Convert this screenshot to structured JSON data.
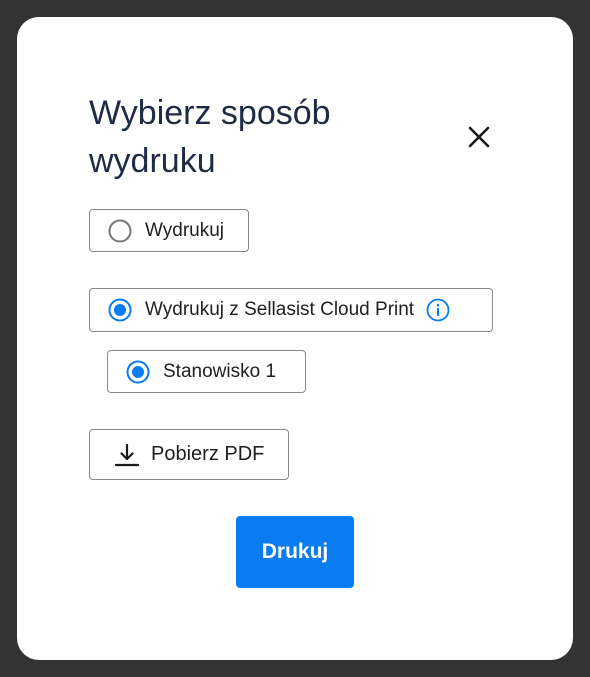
{
  "dialog": {
    "title": "Wybierz sposób wydruku",
    "close_icon": "close-icon",
    "options": {
      "print": {
        "label": "Wydrukuj",
        "selected": false
      },
      "cloud_print": {
        "label": "Wydrukuj z Sellasist Cloud Print",
        "selected": true,
        "info_icon": "info-icon"
      },
      "station": {
        "label": "Stanowisko 1",
        "selected": true
      }
    },
    "download_button": {
      "label": "Pobierz PDF",
      "icon": "download-icon"
    },
    "primary_button": {
      "label": "Drukuj"
    }
  },
  "colors": {
    "backdrop": "#333333",
    "accent": "#0a7cf2",
    "title": "#1f2a44",
    "border": "#8a8a8a"
  }
}
